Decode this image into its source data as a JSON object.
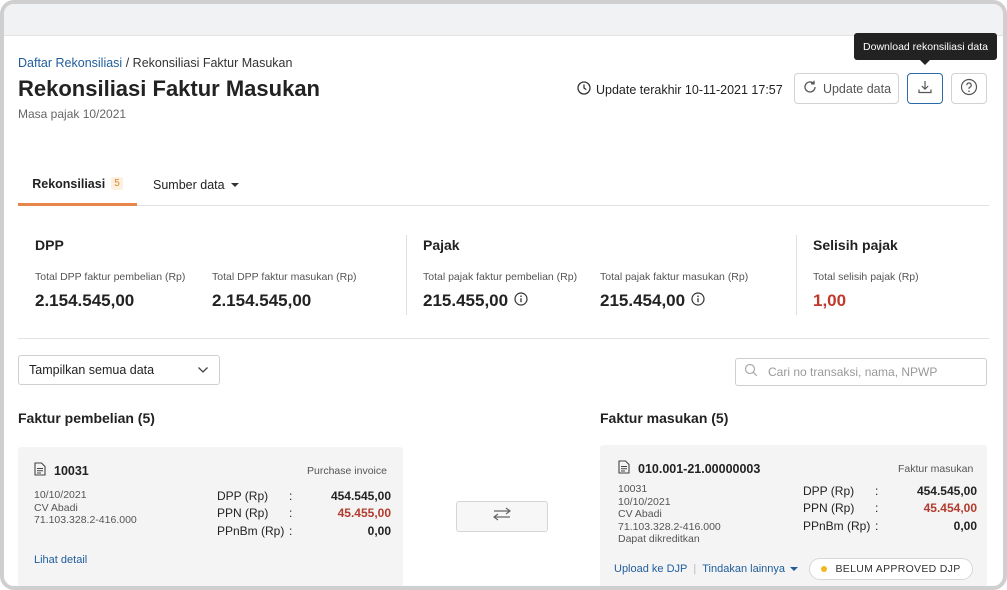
{
  "breadcrumb": {
    "parent": "Daftar Rekonsiliasi",
    "separator": "/",
    "current": "Rekonsiliasi Faktur Masukan"
  },
  "header": {
    "title": "Rekonsiliasi Faktur Masukan",
    "subtitle": "Masa pajak 10/2021",
    "last_update": "Update terakhir 10-11-2021 17:57",
    "update_button": "Update data",
    "download_tooltip": "Download rekonsiliasi data"
  },
  "tabs": [
    {
      "label": "Rekonsiliasi",
      "badge": "5"
    },
    {
      "label": "Sumber data"
    }
  ],
  "summary": {
    "dpp": {
      "title": "DPP",
      "purchase_label": "Total DPP faktur pembelian (Rp)",
      "purchase_value": "2.154.545,00",
      "input_label": "Total DPP faktur masukan (Rp)",
      "input_value": "2.154.545,00"
    },
    "pajak": {
      "title": "Pajak",
      "purchase_label": "Total pajak faktur pembelian (Rp)",
      "purchase_value": "215.455,00",
      "input_label": "Total pajak faktur masukan (Rp)",
      "input_value": "215.454,00"
    },
    "selisih": {
      "title": "Selisih pajak",
      "label": "Total selisih pajak (Rp)",
      "value": "1,00",
      "value_color": "#c0392b"
    }
  },
  "filter": {
    "selected": "Tampilkan semua data"
  },
  "search": {
    "placeholder": "Cari no transaksi, nama, NPWP"
  },
  "left_list": {
    "title": "Faktur pembelian (5)",
    "card": {
      "id": "10031",
      "type": "Purchase invoice",
      "date": "10/10/2021",
      "company": "CV Abadi",
      "npwp": "71.103.328.2-416.000",
      "rows": [
        {
          "label": "DPP (Rp)",
          "colon": ":",
          "value": "454.545,00"
        },
        {
          "label": "PPN (Rp)",
          "colon": ":",
          "value": "45.455,00"
        },
        {
          "label": "PPnBm (Rp)",
          "colon": ":",
          "value": "0,00"
        }
      ],
      "link": "Lihat detail"
    }
  },
  "right_list": {
    "title": "Faktur masukan (5)",
    "card": {
      "id": "010.001-21.00000003",
      "type": "Faktur masukan",
      "ref": "10031",
      "date": "10/10/2021",
      "company": "CV Abadi",
      "npwp": "71.103.328.2-416.000",
      "credit_status": "Dapat dikreditkan",
      "rows": [
        {
          "label": "DPP (Rp)",
          "colon": ":",
          "value": "454.545,00"
        },
        {
          "label": "PPN (Rp)",
          "colon": ":",
          "value": "45.454,00"
        },
        {
          "label": "PPnBm (Rp)",
          "colon": ":",
          "value": "0,00"
        }
      ],
      "upload_link": "Upload ke DJP",
      "divider": "|",
      "other_actions": "Tindakan lainnya",
      "status": "BELUM APPROVED DJP",
      "status_color": "#f0b81d"
    }
  },
  "colors": {
    "accent_link": "#1f5d9b",
    "tab_active": "#e8854b",
    "negative": "#b23b2e"
  }
}
